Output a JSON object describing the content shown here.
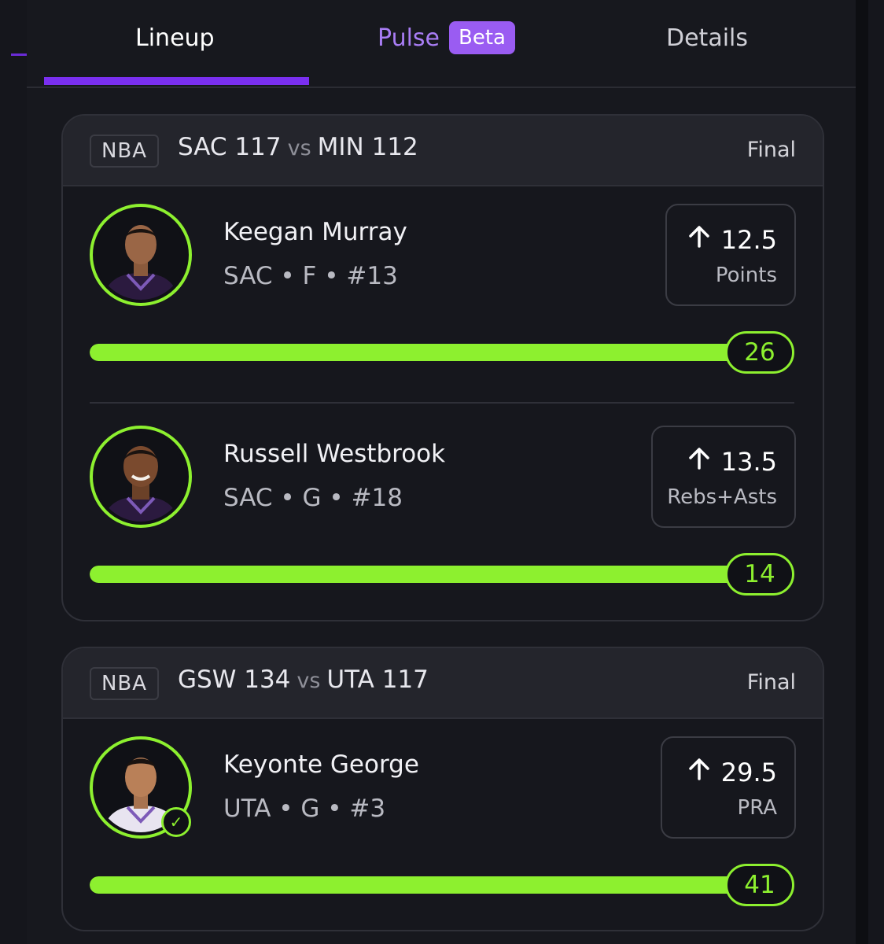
{
  "tabs": {
    "lineup": "Lineup",
    "pulse": "Pulse",
    "pulse_badge": "Beta",
    "details": "Details",
    "active": "lineup"
  },
  "colors": {
    "accent_purple": "#7a2ff0",
    "accent_green": "#8df02f",
    "background": "#101116"
  },
  "games": [
    {
      "league": "NBA",
      "away_team": "SAC",
      "away_score": "117",
      "vs": "vs",
      "home_team": "MIN",
      "home_score": "112",
      "status": "Final",
      "players": [
        {
          "name": "Keegan Murray",
          "team": "SAC",
          "position": "F",
          "number": "#13",
          "meta": "SAC • F • #13",
          "direction_icon": "arrow-up-icon",
          "line": "12.5",
          "stat": "Points",
          "actual": "26",
          "progress_fraction": 1.0,
          "jersey_color": "#2b1a3f"
        },
        {
          "name": "Russell Westbrook",
          "team": "SAC",
          "position": "G",
          "number": "#18",
          "meta": "SAC • G • #18",
          "direction_icon": "arrow-up-icon",
          "line": "13.5",
          "stat": "Rebs+Asts",
          "actual": "14",
          "progress_fraction": 1.0,
          "jersey_color": "#2b1a3f"
        }
      ]
    },
    {
      "league": "NBA",
      "away_team": "GSW",
      "away_score": "134",
      "vs": "vs",
      "home_team": "UTA",
      "home_score": "117",
      "status": "Final",
      "players": [
        {
          "name": "Keyonte George",
          "team": "UTA",
          "position": "G",
          "number": "#3",
          "meta": "UTA • G • #3",
          "direction_icon": "arrow-up-icon",
          "line": "29.5",
          "stat": "PRA",
          "actual": "41",
          "progress_fraction": 1.0,
          "jersey_color": "#e8e4f0",
          "verified_icon": "check-circle-icon"
        }
      ]
    }
  ]
}
